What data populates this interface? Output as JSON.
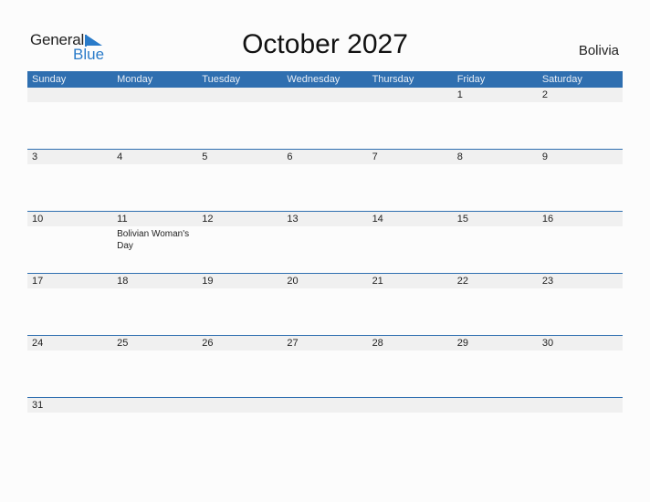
{
  "logo": {
    "line1": "General",
    "line2": "Blue"
  },
  "title": "October 2027",
  "country": "Bolivia",
  "colors": {
    "header": "#2f6fb0",
    "accent": "#2a7bc9",
    "band": "#f0f0f0"
  },
  "weekdays": [
    "Sunday",
    "Monday",
    "Tuesday",
    "Wednesday",
    "Thursday",
    "Friday",
    "Saturday"
  ],
  "weeks": [
    [
      {
        "d": ""
      },
      {
        "d": ""
      },
      {
        "d": ""
      },
      {
        "d": ""
      },
      {
        "d": ""
      },
      {
        "d": "1"
      },
      {
        "d": "2"
      }
    ],
    [
      {
        "d": "3"
      },
      {
        "d": "4"
      },
      {
        "d": "5"
      },
      {
        "d": "6"
      },
      {
        "d": "7"
      },
      {
        "d": "8"
      },
      {
        "d": "9"
      }
    ],
    [
      {
        "d": "10"
      },
      {
        "d": "11",
        "event": "Bolivian Woman's Day"
      },
      {
        "d": "12"
      },
      {
        "d": "13"
      },
      {
        "d": "14"
      },
      {
        "d": "15"
      },
      {
        "d": "16"
      }
    ],
    [
      {
        "d": "17"
      },
      {
        "d": "18"
      },
      {
        "d": "19"
      },
      {
        "d": "20"
      },
      {
        "d": "21"
      },
      {
        "d": "22"
      },
      {
        "d": "23"
      }
    ],
    [
      {
        "d": "24"
      },
      {
        "d": "25"
      },
      {
        "d": "26"
      },
      {
        "d": "27"
      },
      {
        "d": "28"
      },
      {
        "d": "29"
      },
      {
        "d": "30"
      }
    ],
    [
      {
        "d": "31"
      },
      {
        "d": ""
      },
      {
        "d": ""
      },
      {
        "d": ""
      },
      {
        "d": ""
      },
      {
        "d": ""
      },
      {
        "d": ""
      }
    ]
  ]
}
